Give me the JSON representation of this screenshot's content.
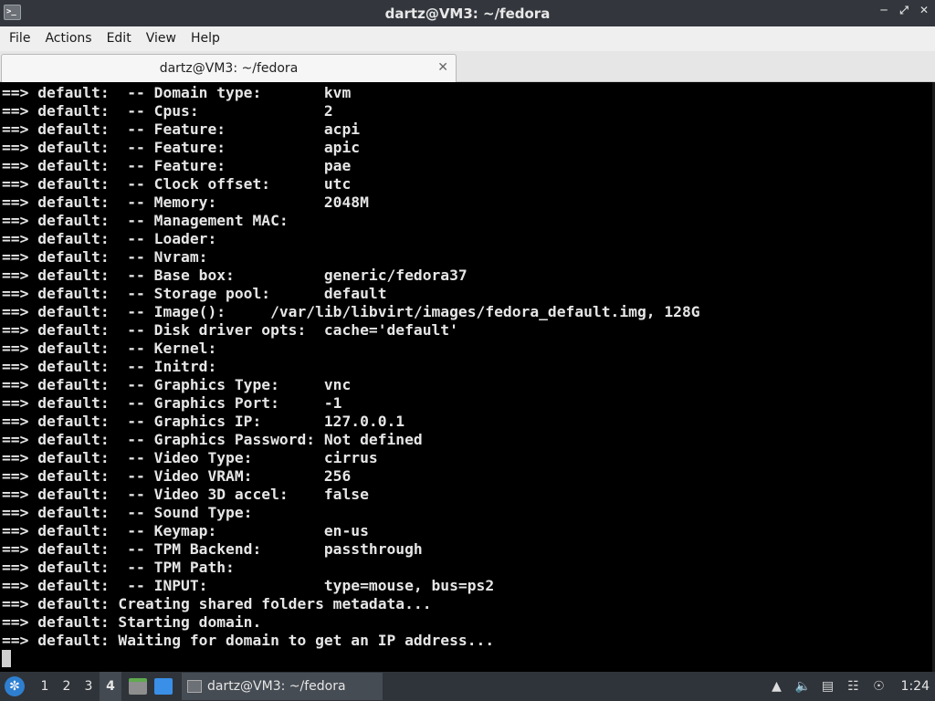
{
  "window": {
    "title": "dartz@VM3: ~/fedora",
    "app_icon": "terminal-icon",
    "controls": [
      "minimize-icon",
      "restore-icon",
      "close-icon"
    ]
  },
  "menu": [
    "File",
    "Actions",
    "Edit",
    "View",
    "Help"
  ],
  "tab": {
    "label": "dartz@VM3: ~/fedora",
    "close": "✕"
  },
  "terminal": {
    "lines": [
      "==> default:  -- Domain type:       kvm",
      "==> default:  -- Cpus:              2",
      "==> default:  -- Feature:           acpi",
      "==> default:  -- Feature:           apic",
      "==> default:  -- Feature:           pae",
      "==> default:  -- Clock offset:      utc",
      "==> default:  -- Memory:            2048M",
      "==> default:  -- Management MAC:",
      "==> default:  -- Loader:",
      "==> default:  -- Nvram:",
      "==> default:  -- Base box:          generic/fedora37",
      "==> default:  -- Storage pool:      default",
      "==> default:  -- Image():     /var/lib/libvirt/images/fedora_default.img, 128G",
      "==> default:  -- Disk driver opts:  cache='default'",
      "==> default:  -- Kernel:",
      "==> default:  -- Initrd:",
      "==> default:  -- Graphics Type:     vnc",
      "==> default:  -- Graphics Port:     -1",
      "==> default:  -- Graphics IP:       127.0.0.1",
      "==> default:  -- Graphics Password: Not defined",
      "==> default:  -- Video Type:        cirrus",
      "==> default:  -- Video VRAM:        256",
      "==> default:  -- Video 3D accel:    false",
      "==> default:  -- Sound Type:",
      "==> default:  -- Keymap:            en-us",
      "==> default:  -- TPM Backend:       passthrough",
      "==> default:  -- TPM Path:",
      "==> default:  -- INPUT:             type=mouse, bus=ps2",
      "==> default: Creating shared folders metadata...",
      "==> default: Starting domain.",
      "==> default: Waiting for domain to get an IP address..."
    ]
  },
  "taskbar": {
    "workspaces": [
      "1",
      "2",
      "3",
      "4"
    ],
    "active_workspace": "4",
    "task_label": "dartz@VM3: ~/fedora",
    "clock": "1:24",
    "tray_icons": [
      "update-icon",
      "volume-icon",
      "network-icon",
      "clipboard-icon",
      "notification-icon"
    ]
  }
}
